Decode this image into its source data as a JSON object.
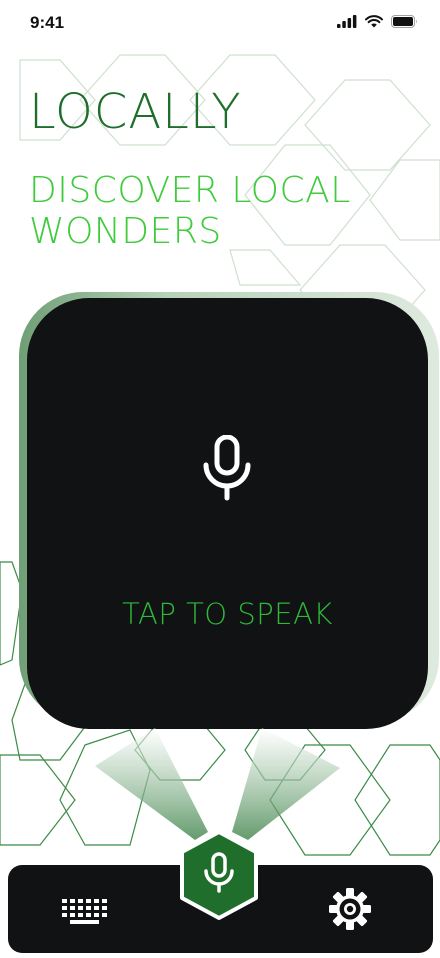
{
  "status_bar": {
    "time": "9:41"
  },
  "app": {
    "title": "LOCALLY",
    "subtitle": "DISCOVER LOCAL WONDERS"
  },
  "voice": {
    "label": "TAP TO SPEAK"
  },
  "colors": {
    "title_green": "#1f6e2c",
    "subtitle_green": "#3fcb3c",
    "label_green": "#2fb83a",
    "fab_green": "#1f6e2c",
    "card_black": "#111213"
  },
  "icons": {
    "signal": "cellular-signal-icon",
    "wifi": "wifi-icon",
    "battery": "battery-icon",
    "mic": "microphone-icon",
    "keyboard": "keyboard-icon",
    "settings": "gear-icon"
  }
}
